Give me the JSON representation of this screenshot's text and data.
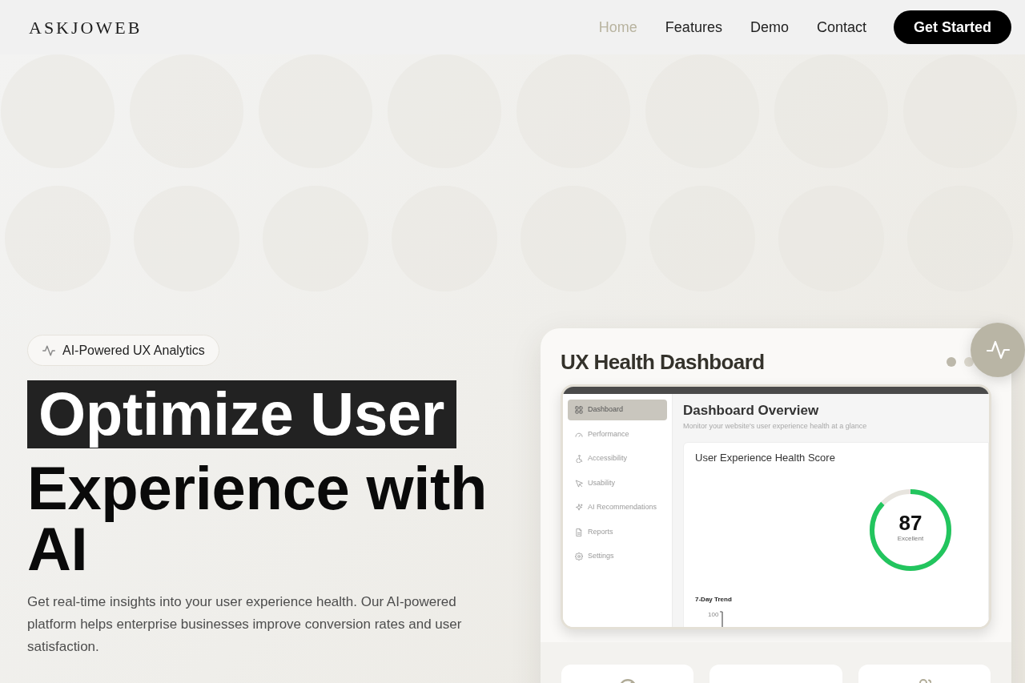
{
  "nav": {
    "logo": "ASKJOWEB",
    "links": [
      {
        "label": "Home",
        "selected": true
      },
      {
        "label": "Features",
        "selected": false
      },
      {
        "label": "Demo",
        "selected": false
      },
      {
        "label": "Contact",
        "selected": false
      }
    ],
    "cta": "Get Started"
  },
  "hero": {
    "badge": "AI-Powered UX Analytics",
    "title_highlight": "Optimize User",
    "title_rest": "Experience with AI",
    "description": "Get real-time insights into your user experience health. Our AI-powered platform helps enterprise businesses improve conversion rates and user satisfaction."
  },
  "dashboard": {
    "title": "UX Health Dashboard",
    "preview": {
      "sidebar": [
        {
          "label": "Dashboard",
          "selected": true
        },
        {
          "label": "Performance",
          "selected": false
        },
        {
          "label": "Accessibility",
          "selected": false
        },
        {
          "label": "Usability",
          "selected": false
        },
        {
          "label": "AI Recommendations",
          "selected": false
        },
        {
          "label": "Reports",
          "selected": false
        },
        {
          "label": "Settings",
          "selected": false
        }
      ],
      "heading": "Dashboard Overview",
      "subheading": "Monitor your website's user experience health at a glance",
      "score_card": {
        "title": "User Experience Health Score",
        "score": "87",
        "rating": "Excellent",
        "level": 0.87
      },
      "trend": {
        "title": "7-Day Trend",
        "y_tick": "100"
      }
    },
    "stat_cards": [
      {
        "kind": "gauge"
      },
      {
        "kind": "blank"
      },
      {
        "kind": "people"
      }
    ]
  }
}
